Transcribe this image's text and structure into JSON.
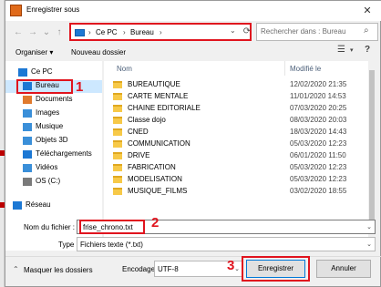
{
  "window": {
    "title": "Enregistrer sous",
    "close_glyph": "✕"
  },
  "address": {
    "path": [
      "Ce PC",
      "Bureau"
    ],
    "separator": "›"
  },
  "search": {
    "placeholder": "Rechercher dans : Bureau"
  },
  "toolbar": {
    "organize": "Organiser ▾",
    "new_folder": "Nouveau dossier"
  },
  "nav": [
    {
      "label": "Ce PC",
      "icon": "pc-icon",
      "color": "#1c78d4"
    },
    {
      "label": "Bureau",
      "icon": "desktop-icon",
      "color": "#1c78d4",
      "selected": true
    },
    {
      "label": "Documents",
      "icon": "documents-icon",
      "color": "#e07a2e"
    },
    {
      "label": "Images",
      "icon": "images-icon",
      "color": "#3a8fd9"
    },
    {
      "label": "Musique",
      "icon": "music-icon",
      "color": "#3a8fd9"
    },
    {
      "label": "Objets 3D",
      "icon": "objects3d-icon",
      "color": "#3a8fd9"
    },
    {
      "label": "Téléchargements",
      "icon": "downloads-icon",
      "color": "#1c78d4"
    },
    {
      "label": "Vidéos",
      "icon": "videos-icon",
      "color": "#3a8fd9"
    },
    {
      "label": "OS (C:)",
      "icon": "drive-icon",
      "color": "#7a7a7a"
    },
    {
      "label": "Réseau",
      "icon": "network-icon",
      "color": "#1c78d4"
    }
  ],
  "files": {
    "columns": {
      "name": "Nom",
      "modified": "Modifié le"
    },
    "rows": [
      {
        "name": "BUREAUTIQUE",
        "modified": "12/02/2020 21:35"
      },
      {
        "name": "CARTE MENTALE",
        "modified": "11/01/2020 14:53"
      },
      {
        "name": "CHAINE EDITORIALE",
        "modified": "07/03/2020 20:25"
      },
      {
        "name": "Classe dojo",
        "modified": "08/03/2020 20:03"
      },
      {
        "name": "CNED",
        "modified": "18/03/2020 14:43"
      },
      {
        "name": "COMMUNICATION",
        "modified": "05/03/2020 12:23"
      },
      {
        "name": "DRIVE",
        "modified": "06/01/2020 11:50"
      },
      {
        "name": "FABRICATION",
        "modified": "05/03/2020 12:23"
      },
      {
        "name": "MODELISATION",
        "modified": "05/03/2020 12:23"
      },
      {
        "name": "MUSIQUE_FILMS",
        "modified": "03/02/2020 18:55"
      }
    ]
  },
  "filename": {
    "label": "Nom du fichier :",
    "value": "frise_chrono.txt"
  },
  "type": {
    "label": "Type :",
    "value": "Fichiers texte (*.txt)"
  },
  "footer": {
    "hide_folders": "Masquer les dossiers",
    "encoding_label": "Encodage :",
    "encoding_value": "UTF-8",
    "save": "Enregistrer",
    "cancel": "Annuler"
  },
  "annotations": {
    "one": "1",
    "two": "2",
    "three": "3"
  },
  "colors": {
    "highlight": "#e0141e",
    "accent": "#0078d7",
    "selected": "#cde8ff"
  }
}
